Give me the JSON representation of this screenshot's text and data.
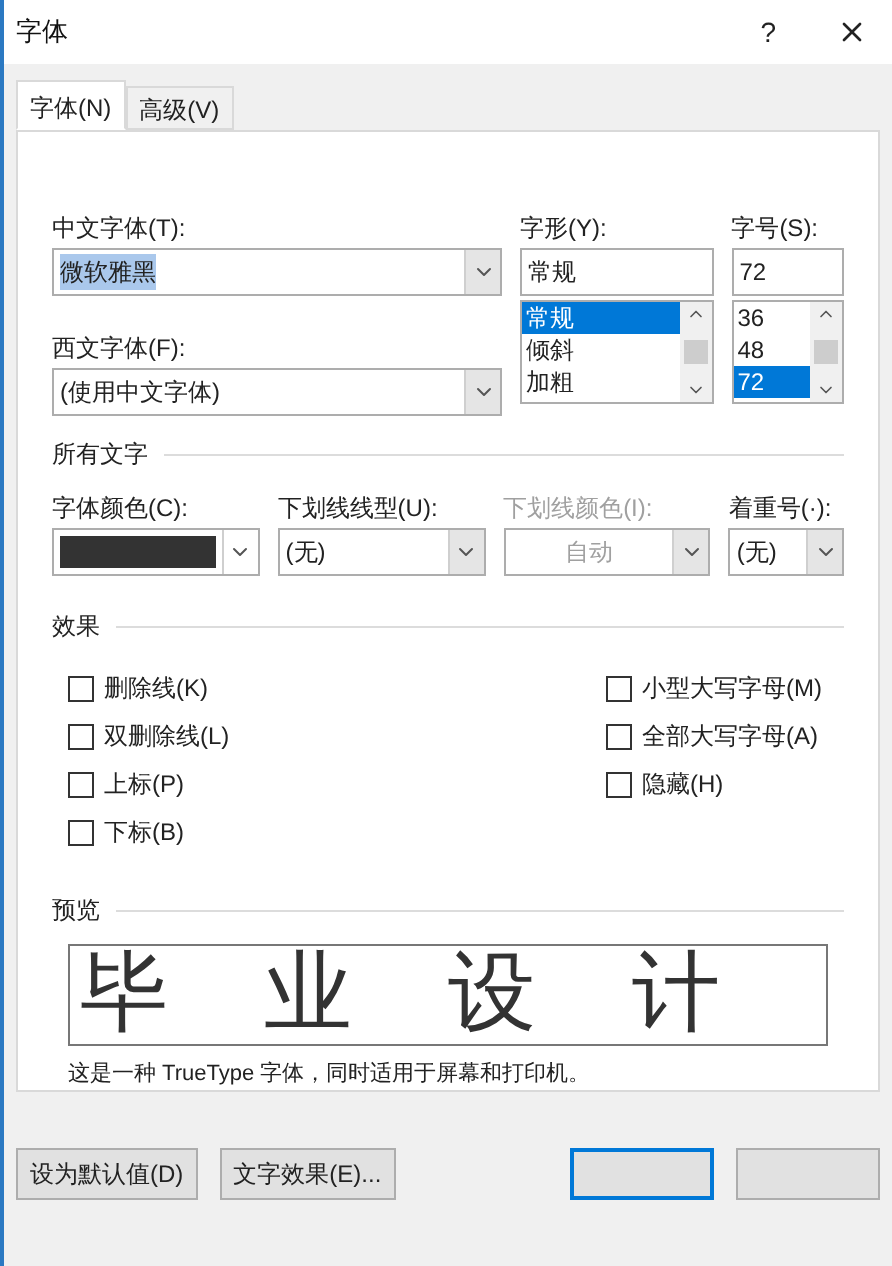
{
  "window": {
    "title": "字体",
    "help": "?"
  },
  "tabs": [
    {
      "label": "字体(N)",
      "selected": true
    },
    {
      "label": "高级(V)",
      "selected": false
    }
  ],
  "fonts": {
    "chinese": {
      "label": "中文字体(T):",
      "value": "微软雅黑",
      "highlighted": true
    },
    "western": {
      "label": "西文字体(F):",
      "value": "(使用中文字体)",
      "highlighted": false
    },
    "style": {
      "label": "字形(Y):",
      "value": "常规",
      "options": [
        {
          "label": "常规",
          "selected": true
        },
        {
          "label": "倾斜",
          "selected": false
        },
        {
          "label": "加粗",
          "selected": false
        }
      ]
    },
    "size": {
      "label": "字号(S):",
      "value": "72",
      "options": [
        {
          "label": "36",
          "selected": false
        },
        {
          "label": "48",
          "selected": false
        },
        {
          "label": "72",
          "selected": true
        }
      ]
    }
  },
  "all_text": {
    "heading": "所有文字",
    "fields": [
      {
        "kind": "color",
        "label": "字体颜色(C):",
        "color": "#333333",
        "disabled": false
      },
      {
        "kind": "select",
        "label": "下划线线型(U):",
        "value": "(无)",
        "disabled": false
      },
      {
        "kind": "select",
        "label": "下划线颜色(I):",
        "value": "自动",
        "disabled": true
      },
      {
        "kind": "select",
        "label": "着重号(·):",
        "value": "(无)",
        "disabled": false
      }
    ]
  },
  "effects": {
    "heading": "效果",
    "left": [
      {
        "label": "删除线(K)",
        "checked": false
      },
      {
        "label": "双删除线(L)",
        "checked": false
      },
      {
        "label": "上标(P)",
        "checked": false
      },
      {
        "label": "下标(B)",
        "checked": false
      }
    ],
    "right": [
      {
        "label": "小型大写字母(M)",
        "checked": false
      },
      {
        "label": "全部大写字母(A)",
        "checked": false
      },
      {
        "label": "隐藏(H)",
        "checked": false
      }
    ]
  },
  "preview": {
    "heading": "预览",
    "sample": "毕业设计",
    "note": "这是一种 TrueType 字体，同时适用于屏幕和打印机。"
  },
  "buttons": [
    {
      "label": "设为默认值(D)"
    },
    {
      "label": "文字效果(E)..."
    }
  ],
  "dialog_buttons": [
    {
      "default": true
    },
    {
      "default": false
    }
  ]
}
